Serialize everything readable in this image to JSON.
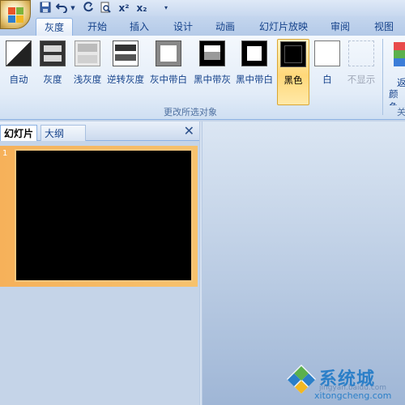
{
  "quick_access": {
    "icons": [
      "save-icon",
      "undo-icon",
      "redo-icon",
      "print-preview-icon",
      "superscript-icon",
      "subscript-icon",
      "customize-dropdown-icon"
    ],
    "superscript_label": "x²",
    "subscript_label": "x₂"
  },
  "tabs": [
    {
      "label": "灰度",
      "active": true
    },
    {
      "label": "开始"
    },
    {
      "label": "插入"
    },
    {
      "label": "设计"
    },
    {
      "label": "动画"
    },
    {
      "label": "幻灯片放映"
    },
    {
      "label": "审阅"
    },
    {
      "label": "视图"
    }
  ],
  "ribbon": {
    "buttons": [
      {
        "label": "自动"
      },
      {
        "label": "灰度"
      },
      {
        "label": "浅灰度"
      },
      {
        "label": "逆转灰度"
      },
      {
        "label": "灰中带白"
      },
      {
        "label": "黑中带灰"
      },
      {
        "label": "黑中带白"
      },
      {
        "label": "黑色",
        "selected": true
      },
      {
        "label": "白"
      },
      {
        "label": "不显示",
        "disabled": true
      }
    ],
    "group_label": "更改所选对象",
    "next_group_partial": [
      "返",
      "颜色",
      "关"
    ]
  },
  "left_pane": {
    "tab_slides": "幻灯片",
    "tab_outline": "大纲",
    "close_glyph": "✕",
    "slide_number": "1"
  },
  "watermark": {
    "chinese": "系统城",
    "english": "xitongcheng.com",
    "baidu": "jingyan.baidu.com"
  },
  "colors": {
    "accent": "#15428b",
    "selected_bg": "#ffd87a",
    "slide_row": "#f6b15a"
  }
}
